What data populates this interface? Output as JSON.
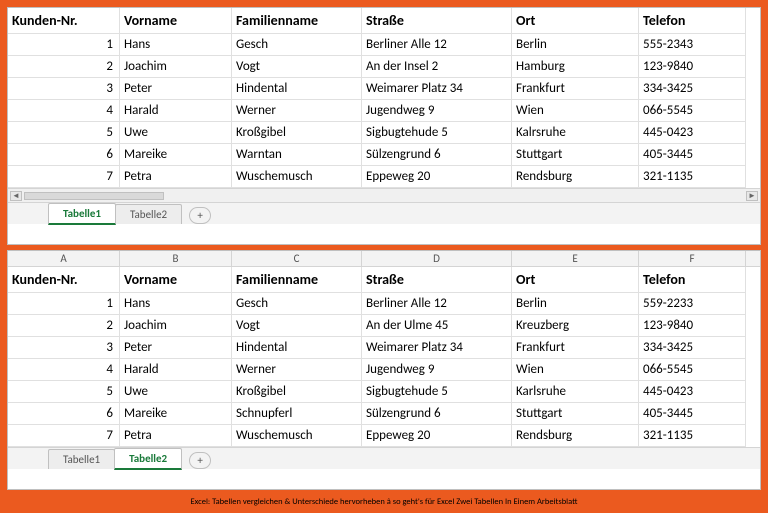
{
  "columns": [
    "A",
    "B",
    "C",
    "D",
    "E",
    "F"
  ],
  "headers": [
    "Kunden-Nr.",
    "Vorname",
    "Familienname",
    "Straße",
    "Ort",
    "Telefon"
  ],
  "table1": {
    "rows": [
      {
        "id": "1",
        "vor": "Hans",
        "fam": "Gesch",
        "str": "Berliner Alle 12",
        "ort": "Berlin",
        "tel": "555-2343"
      },
      {
        "id": "2",
        "vor": "Joachim",
        "fam": "Vogt",
        "str": "An der Insel 2",
        "ort": "Hamburg",
        "tel": "123-9840"
      },
      {
        "id": "3",
        "vor": "Peter",
        "fam": "Hindental",
        "str": "Weimarer Platz 34",
        "ort": "Frankfurt",
        "tel": "334-3425"
      },
      {
        "id": "4",
        "vor": "Harald",
        "fam": "Werner",
        "str": "Jugendweg 9",
        "ort": "Wien",
        "tel": "066-5545"
      },
      {
        "id": "5",
        "vor": "Uwe",
        "fam": "Kroßgibel",
        "str": "Sigbugtehude 5",
        "ort": "Kalrsruhe",
        "tel": "445-0423"
      },
      {
        "id": "6",
        "vor": "Mareike",
        "fam": "Warntan",
        "str": "Sülzengrund 6",
        "ort": "Stuttgart",
        "tel": "405-3445"
      },
      {
        "id": "7",
        "vor": "Petra",
        "fam": "Wuschemusch",
        "str": "Eppeweg 20",
        "ort": "Rendsburg",
        "tel": "321-1135"
      }
    ],
    "tabs": [
      "Tabelle1",
      "Tabelle2"
    ],
    "active_tab": 0
  },
  "table2": {
    "rows": [
      {
        "id": "1",
        "vor": "Hans",
        "fam": "Gesch",
        "str": "Berliner Alle 12",
        "ort": "Berlin",
        "tel": "559-2233"
      },
      {
        "id": "2",
        "vor": "Joachim",
        "fam": "Vogt",
        "str": "An der Ulme 45",
        "ort": "Kreuzberg",
        "tel": "123-9840"
      },
      {
        "id": "3",
        "vor": "Peter",
        "fam": "Hindental",
        "str": "Weimarer Platz 34",
        "ort": "Frankfurt",
        "tel": "334-3425"
      },
      {
        "id": "4",
        "vor": "Harald",
        "fam": "Werner",
        "str": "Jugendweg 9",
        "ort": "Wien",
        "tel": "066-5545"
      },
      {
        "id": "5",
        "vor": "Uwe",
        "fam": "Kroßgibel",
        "str": "Sigbugtehude 5",
        "ort": "Karlsruhe",
        "tel": "445-0423"
      },
      {
        "id": "6",
        "vor": "Mareike",
        "fam": "Schnupferl",
        "str": "Sülzengrund 6",
        "ort": "Stuttgart",
        "tel": "405-3445"
      },
      {
        "id": "7",
        "vor": "Petra",
        "fam": "Wuschemusch",
        "str": "Eppeweg 20",
        "ort": "Rendsburg",
        "tel": "321-1135"
      }
    ],
    "tabs": [
      "Tabelle1",
      "Tabelle2"
    ],
    "active_tab": 1
  },
  "add_label": "+",
  "caption": "Excel: Tabellen vergleichen & Unterschiede hervorheben â so geht's für Excel Zwei Tabellen In Einem Arbeitsblatt"
}
